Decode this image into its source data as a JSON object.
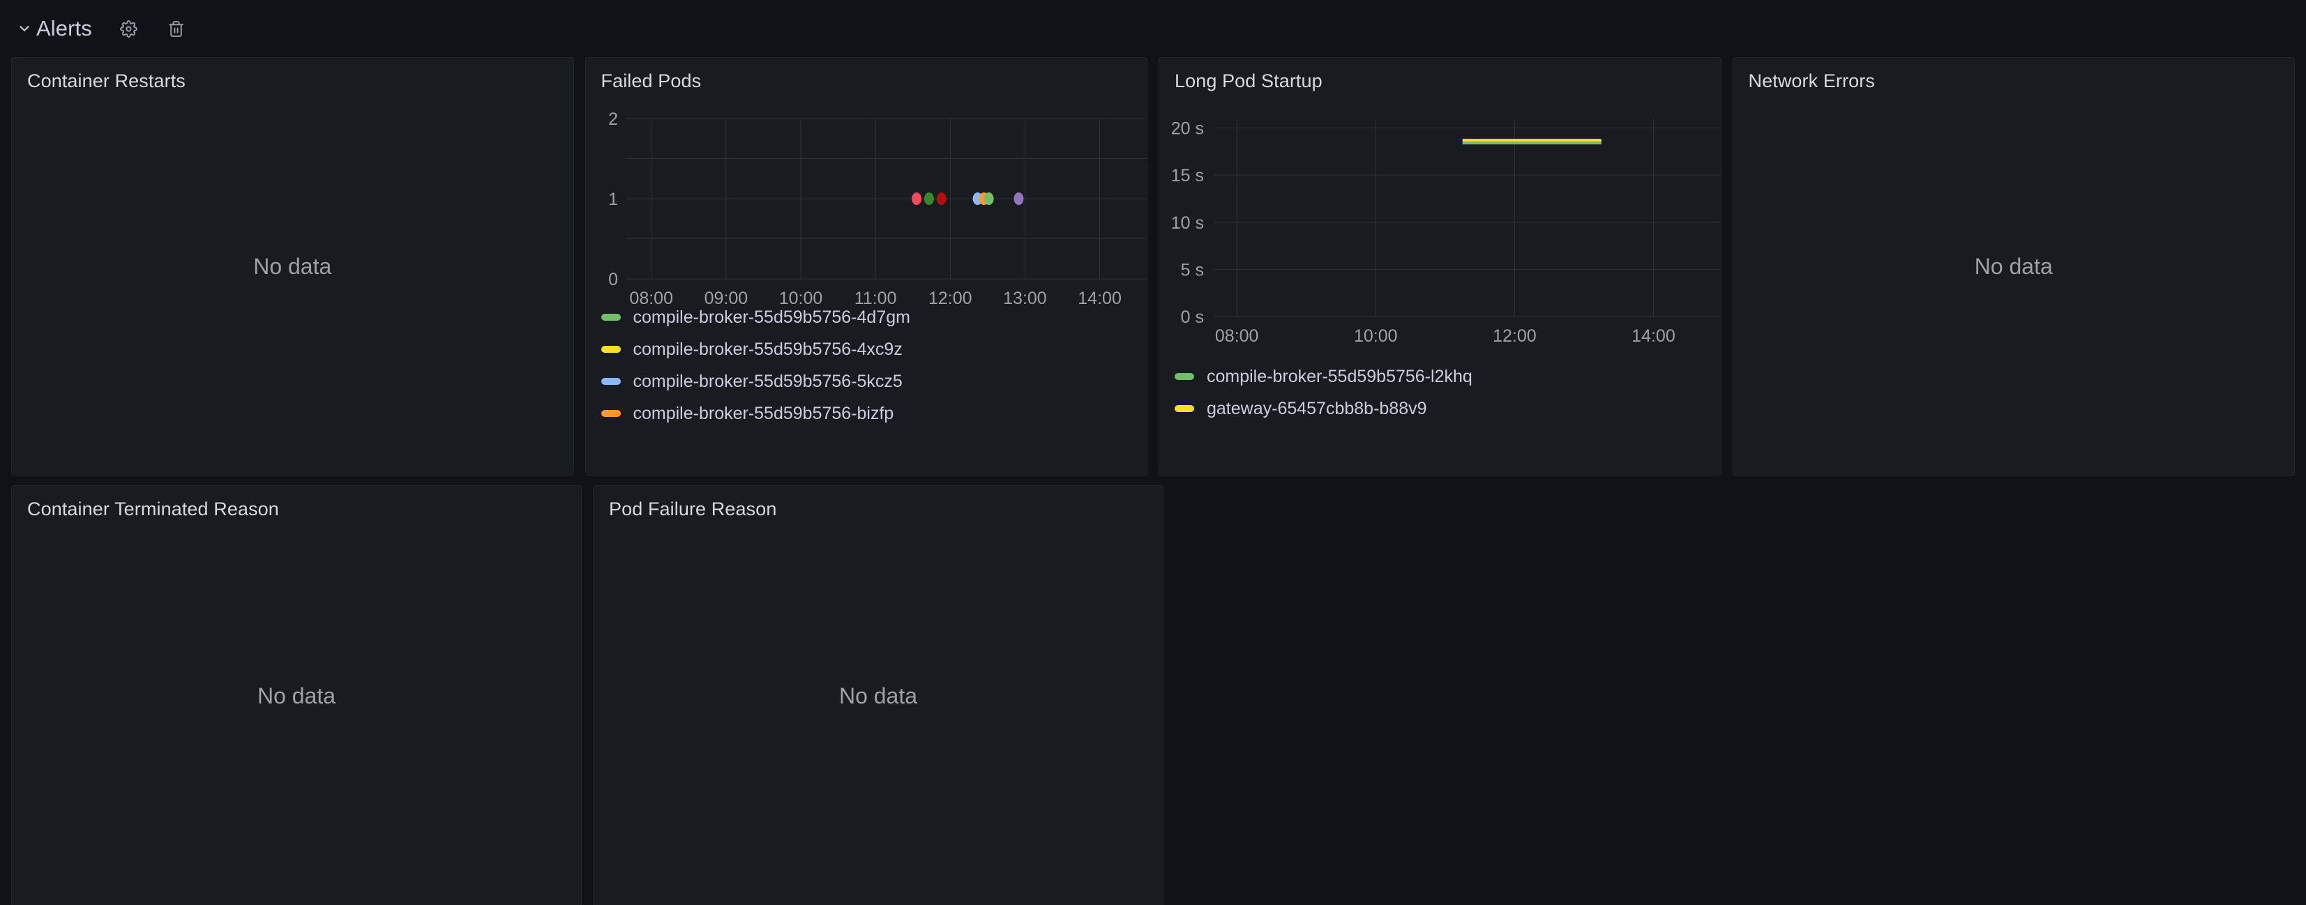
{
  "row": {
    "title": "Alerts",
    "chevron_icon": "chevron-down-icon",
    "settings_icon": "gear-icon",
    "delete_icon": "trash-icon",
    "expanded": true
  },
  "messages": {
    "no_data": "No data"
  },
  "panels": [
    {
      "id": "container-restarts",
      "title": "Container Restarts",
      "state": "no-data"
    },
    {
      "id": "failed-pods",
      "title": "Failed Pods",
      "state": "chart"
    },
    {
      "id": "long-pod-startup",
      "title": "Long Pod Startup",
      "state": "chart"
    },
    {
      "id": "network-errors",
      "title": "Network Errors",
      "state": "no-data"
    },
    {
      "id": "container-terminated-reason",
      "title": "Container Terminated Reason",
      "state": "no-data"
    },
    {
      "id": "pod-failure-reason",
      "title": "Pod Failure Reason",
      "state": "no-data"
    }
  ],
  "colors": {
    "panel_bg": "#181b1f",
    "dashboard_bg": "#111217",
    "panel_border": "#23262b",
    "grid": "#2c3235",
    "text": "#ccccdc",
    "axis_text": "#9fa1a6",
    "green": "#73bf69",
    "yellow": "#fade2a",
    "blue": "#8ab8ff",
    "orange": "#ff9830",
    "red": "#f2495c",
    "dark_red": "#b30d0d",
    "purple": "#8f77ba",
    "dark_green": "#37872d"
  },
  "chart_data": [
    {
      "panel": "failed-pods",
      "type": "scatter",
      "title": "Failed Pods",
      "xlabel": "",
      "ylabel": "",
      "x_ticks": [
        "08:00",
        "09:00",
        "10:00",
        "11:00",
        "12:00",
        "13:00",
        "14:00"
      ],
      "y_ticks": [
        "0",
        "1",
        "2"
      ],
      "ylim": [
        0,
        2
      ],
      "xlim": [
        "07:40",
        "14:40"
      ],
      "grid": true,
      "legend_position": "bottom",
      "points": [
        {
          "x": "11:33",
          "y": 1,
          "color": "#f2495c"
        },
        {
          "x": "11:43",
          "y": 1,
          "color": "#37872d"
        },
        {
          "x": "11:53",
          "y": 1,
          "color": "#b30d0d"
        },
        {
          "x": "12:22",
          "y": 1,
          "color": "#8ab8ff"
        },
        {
          "x": "12:27",
          "y": 1,
          "color": "#ff9830"
        },
        {
          "x": "12:31",
          "y": 1,
          "color": "#73bf69"
        },
        {
          "x": "12:55",
          "y": 1,
          "color": "#8f77ba"
        }
      ],
      "legend": [
        {
          "label": "compile-broker-55d59b5756-4d7gm",
          "color": "#73bf69"
        },
        {
          "label": "compile-broker-55d59b5756-4xc9z",
          "color": "#fade2a"
        },
        {
          "label": "compile-broker-55d59b5756-5kcz5",
          "color": "#8ab8ff"
        },
        {
          "label": "compile-broker-55d59b5756-bizfp",
          "color": "#ff9830"
        }
      ]
    },
    {
      "panel": "long-pod-startup",
      "type": "line",
      "title": "Long Pod Startup",
      "xlabel": "",
      "ylabel": "",
      "x_ticks": [
        "08:00",
        "10:00",
        "12:00",
        "14:00"
      ],
      "y_ticks": [
        "0 s",
        "5 s",
        "10 s",
        "15 s",
        "20 s"
      ],
      "ylim": [
        0,
        21
      ],
      "xlim": [
        "07:40",
        "15:00"
      ],
      "grid": true,
      "legend_position": "bottom",
      "series": [
        {
          "name": "compile-broker-55d59b5756-l2khq",
          "color": "#73bf69",
          "x_start": "11:15",
          "x_end": "13:15",
          "value": 18.4
        },
        {
          "name": "gateway-65457cbb8b-b88v9",
          "color": "#fade2a",
          "x_start": "11:15",
          "x_end": "13:15",
          "value": 18.7
        }
      ],
      "legend": [
        {
          "label": "compile-broker-55d59b5756-l2khq",
          "color": "#73bf69"
        },
        {
          "label": "gateway-65457cbb8b-b88v9",
          "color": "#fade2a"
        }
      ]
    }
  ]
}
